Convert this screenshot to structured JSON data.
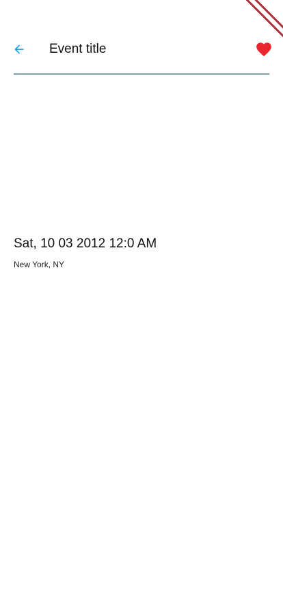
{
  "header": {
    "back_icon": "arrow-left-icon",
    "title": "Event title",
    "favorite_icon": "heart-icon"
  },
  "event": {
    "date": "Sat, 10 03 2012 12:0 AM",
    "location": "New York, NY"
  },
  "colors": {
    "accent": "#1a9be0",
    "favorite": "#e8262c",
    "divider": "#7f9fb0",
    "debug_banner": "#a8323c"
  }
}
